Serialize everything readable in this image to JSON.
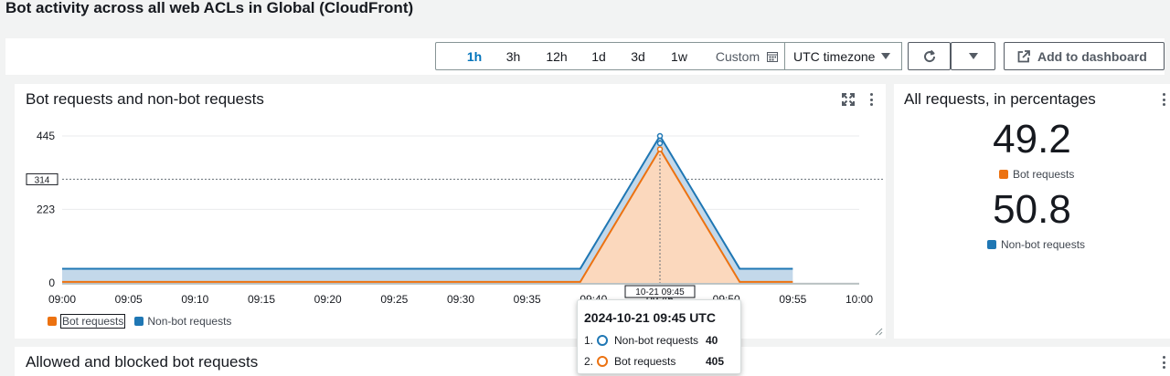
{
  "page": {
    "title": "Bot activity across all web ACLs in Global (CloudFront)"
  },
  "toolbar": {
    "ranges": [
      "1h",
      "3h",
      "12h",
      "1d",
      "3d",
      "1w"
    ],
    "active_range": "1h",
    "custom_label": "Custom",
    "timezone_label": "UTC timezone",
    "add_dashboard_label": "Add to dashboard"
  },
  "main_panel": {
    "title": "Bot requests and non-bot requests",
    "hover_marker_value": "314",
    "hover_time_label": "10-21 09:45",
    "legend": [
      {
        "label": "Bot requests",
        "color": "#ec7211"
      },
      {
        "label": "Non-bot requests",
        "color": "#1f77b4"
      }
    ]
  },
  "chart_data": {
    "type": "area",
    "x": [
      "09:00",
      "09:05",
      "09:10",
      "09:15",
      "09:20",
      "09:25",
      "09:30",
      "09:35",
      "09:40",
      "09:45",
      "09:50",
      "09:55",
      "10:00"
    ],
    "x_ticks": [
      "09:00",
      "09:05",
      "09:10",
      "09:15",
      "09:20",
      "09:25",
      "09:30",
      "09:35",
      "09:40",
      "09:45",
      "09:50",
      "09:55",
      "10:00"
    ],
    "y_ticks": [
      "0",
      "223",
      "445"
    ],
    "ylim": [
      0,
      445
    ],
    "stacked": true,
    "series": [
      {
        "name": "Bot requests",
        "color": "#ec7211",
        "points": [
          [
            "09:00",
            3
          ],
          [
            "09:39",
            3
          ],
          [
            "09:45",
            405
          ],
          [
            "09:51",
            3
          ],
          [
            "09:55",
            3
          ]
        ]
      },
      {
        "name": "Non-bot requests",
        "color": "#1f77b4",
        "points": [
          [
            "09:00",
            40
          ],
          [
            "09:39",
            40
          ],
          [
            "09:45",
            40
          ],
          [
            "09:51",
            40
          ],
          [
            "09:55",
            40
          ]
        ]
      }
    ],
    "reference_line": 314,
    "grid": true,
    "legend_position": "bottom-left"
  },
  "percent_panel": {
    "title": "All requests, in percentages",
    "items": [
      {
        "value": "49.2",
        "label": "Bot requests",
        "color": "#ec7211"
      },
      {
        "value": "50.8",
        "label": "Non-bot requests",
        "color": "#1f77b4"
      }
    ]
  },
  "tooltip": {
    "title": "2024-10-21 09:45 UTC",
    "rows": [
      {
        "index": "1.",
        "label": "Non-bot requests",
        "value": "40",
        "color": "#1f77b4"
      },
      {
        "index": "2.",
        "label": "Bot requests",
        "value": "405",
        "color": "#ec7211"
      }
    ]
  },
  "bottom_panel": {
    "title": "Allowed and blocked bot requests"
  }
}
